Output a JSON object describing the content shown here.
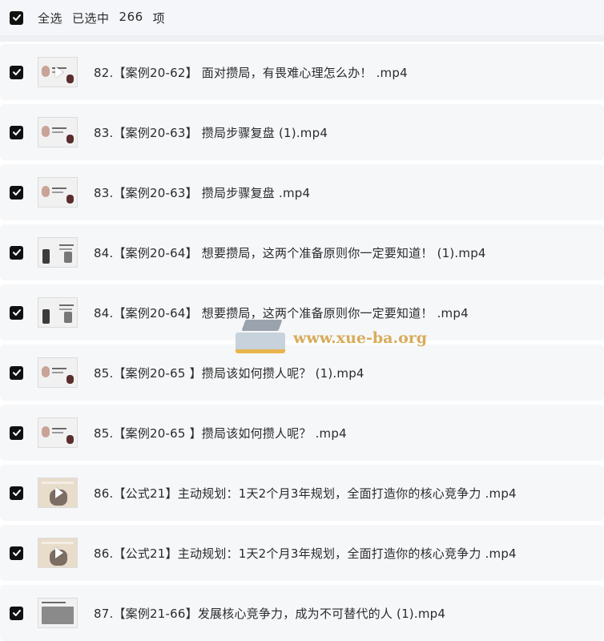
{
  "header": {
    "select_all_label": "全选",
    "selected_prefix": "已选中",
    "selected_count": "266",
    "selected_suffix": "项",
    "select_all_checked": true
  },
  "files": [
    {
      "name": "82.【案例20-62】 面对攒局，有畏难心理怎么办！ .mp4",
      "checked": true,
      "thumb": "thumb-portrait-play"
    },
    {
      "name": "83.【案例20-63】 攒局步骤复盘 (1).mp4",
      "checked": true,
      "thumb": "thumb-portrait"
    },
    {
      "name": "83.【案例20-63】 攒局步骤复盘 .mp4",
      "checked": true,
      "thumb": "thumb-portrait"
    },
    {
      "name": "84.【案例20-64】 想要攒局，这两个准备原则你一定要知道！ (1).mp4",
      "checked": true,
      "thumb": "thumb-slide"
    },
    {
      "name": "84.【案例20-64】 想要攒局，这两个准备原则你一定要知道！ .mp4",
      "checked": true,
      "thumb": "thumb-slide"
    },
    {
      "name": "85.【案例20-65 】攒局该如何攒人呢？ (1).mp4",
      "checked": true,
      "thumb": "thumb-portrait"
    },
    {
      "name": "85.【案例20-65 】攒局该如何攒人呢？ .mp4",
      "checked": true,
      "thumb": "thumb-portrait"
    },
    {
      "name": "86.【公式21】主动规划：1天2个月3年规划，全面打造你的核心竞争力 .mp4",
      "checked": true,
      "thumb": "thumb-scene-play"
    },
    {
      "name": "86.【公式21】主动规划：1天2个月3年规划，全面打造你的核心竞争力 .mp4",
      "checked": true,
      "thumb": "thumb-scene-play"
    },
    {
      "name": "87.【案例21-66】发展核心竞争力，成为不可替代的人 (1).mp4",
      "checked": true,
      "thumb": "thumb-photo"
    }
  ],
  "watermark": {
    "text": "www.xue-ba.org"
  },
  "colors": {
    "checkbox": "#111111",
    "row_background": "#f6f7f9",
    "header_background": "#f4f6f9",
    "watermark": "#d5a44a"
  }
}
